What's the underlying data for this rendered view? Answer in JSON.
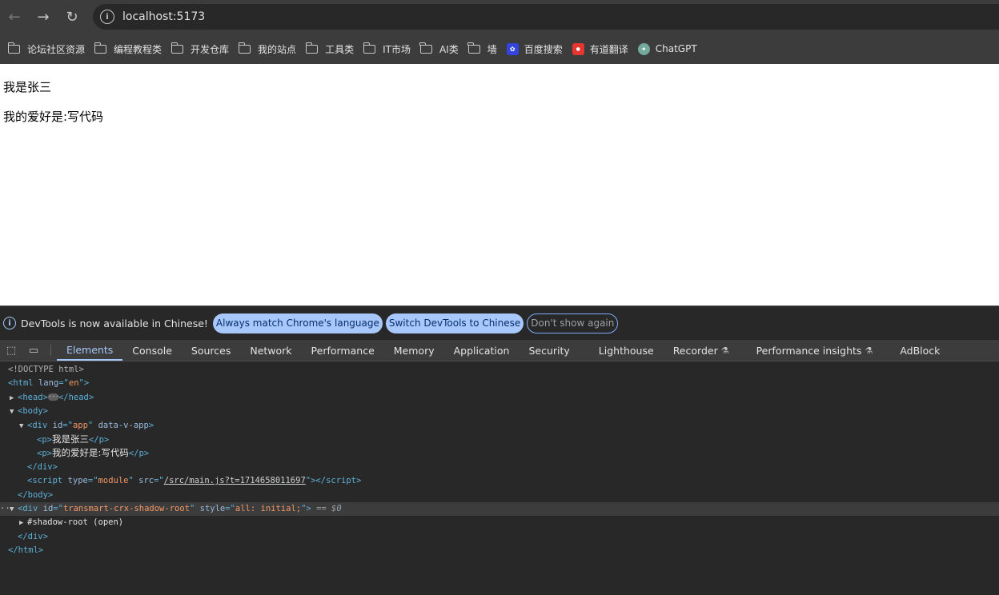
{
  "browser": {
    "url": "localhost:5173",
    "bookmarks": [
      {
        "label": "论坛社区资源",
        "icon": "folder-icon"
      },
      {
        "label": "编程教程类",
        "icon": "folder-icon"
      },
      {
        "label": "开发仓库",
        "icon": "folder-icon"
      },
      {
        "label": "我的站点",
        "icon": "folder-icon"
      },
      {
        "label": "工具类",
        "icon": "folder-icon"
      },
      {
        "label": "IT市场",
        "icon": "folder-icon"
      },
      {
        "label": "AI类",
        "icon": "folder-icon"
      },
      {
        "label": "墙",
        "icon": "folder-icon"
      },
      {
        "label": "百度搜索",
        "icon": "baidu-icon"
      },
      {
        "label": "有道翻译",
        "icon": "youdao-icon"
      },
      {
        "label": "ChatGPT",
        "icon": "chatgpt-icon"
      }
    ]
  },
  "page": {
    "line1": "我是张三",
    "line2": "我的爱好是:写代码"
  },
  "devtools": {
    "infobar": {
      "message": "DevTools is now available in Chinese!",
      "btn_match": "Always match Chrome's language",
      "btn_switch": "Switch DevTools to Chinese",
      "btn_dismiss": "Don't show again"
    },
    "tabs": [
      "Elements",
      "Console",
      "Sources",
      "Network",
      "Performance",
      "Memory",
      "Application",
      "Security",
      "Lighthouse",
      "Recorder",
      "Performance insights",
      "AdBlock"
    ],
    "active_tab": "Elements",
    "tree": {
      "doctype": "<!DOCTYPE html>",
      "html_lang": "en",
      "app_id": "app",
      "app_attr": "data-v-app",
      "p1": "我是张三",
      "p2": "我的爱好是:写代码",
      "script_type": "module",
      "script_src": "/src/main.js?t=1714658011697",
      "shadow_div_id": "transmart-crx-shadow-root",
      "shadow_div_style": "all: initial;",
      "selected_marker": "== $0",
      "shadow_root": "#shadow-root (open)"
    }
  },
  "colors": {
    "accent": "#a8c7fa",
    "tag": "#5db0d7",
    "attr_value": "#f29766"
  }
}
